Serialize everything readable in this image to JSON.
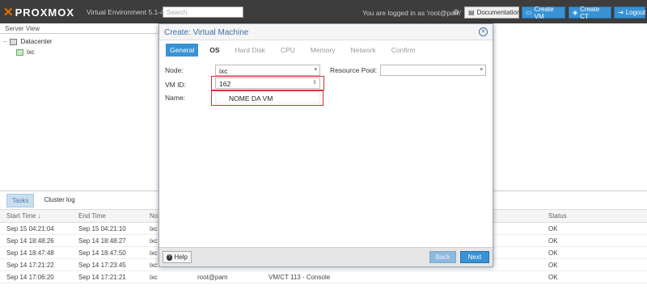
{
  "app": {
    "logo": "PROXMOX",
    "version": "Virtual Environment 5.1-41",
    "search_placeholder": "Search",
    "logged_in": "You are logged in as 'root@pam'",
    "buttons": {
      "docs": "Documentation",
      "create_vm": "Create VM",
      "create_ct": "Create CT",
      "logout": "Logout"
    }
  },
  "tree": {
    "view": "Server View",
    "items": [
      {
        "label": "Datacenter"
      },
      {
        "label": "ixc"
      }
    ]
  },
  "bottom": {
    "tabs": [
      "Tasks",
      "Cluster log"
    ],
    "columns": [
      "Start Time ↓",
      "End Time",
      "No",
      "",
      "",
      "Status"
    ],
    "rows": [
      {
        "start": "Sep 15 04:21:04",
        "end": "Sep 15 04:21:10",
        "node": "ixc",
        "user": "",
        "desc": "",
        "status": "OK"
      },
      {
        "start": "Sep 14 18:48:26",
        "end": "Sep 14 18:48:27",
        "node": "ixc",
        "user": "",
        "desc": "",
        "status": "OK"
      },
      {
        "start": "Sep 14 18:47:48",
        "end": "Sep 14 18:47:50",
        "node": "ixc",
        "user": "",
        "desc": "",
        "status": "OK"
      },
      {
        "start": "Sep 14 17:21:22",
        "end": "Sep 14 17:23:45",
        "node": "ixc",
        "user": "",
        "desc": "",
        "status": "OK"
      },
      {
        "start": "Sep 14 17:06:20",
        "end": "Sep 14 17:21:21",
        "node": "ixc",
        "user": "root@pam",
        "desc": "VM/CT 113 - Console",
        "status": "OK"
      }
    ]
  },
  "modal": {
    "title": "Create: Virtual Machine",
    "tabs": [
      "General",
      "OS",
      "Hard Disk",
      "CPU",
      "Memory",
      "Network",
      "Confirm"
    ],
    "fields": {
      "node_label": "Node:",
      "node_value": "ixc",
      "pool_label": "Resource Pool:",
      "pool_value": "",
      "vmid_label": "VM ID:",
      "vmid_value": "162",
      "name_label": "Name:",
      "name_value": "NOME DA VM"
    },
    "footer": {
      "help": "Help",
      "back": "Back",
      "next": "Next"
    }
  }
}
